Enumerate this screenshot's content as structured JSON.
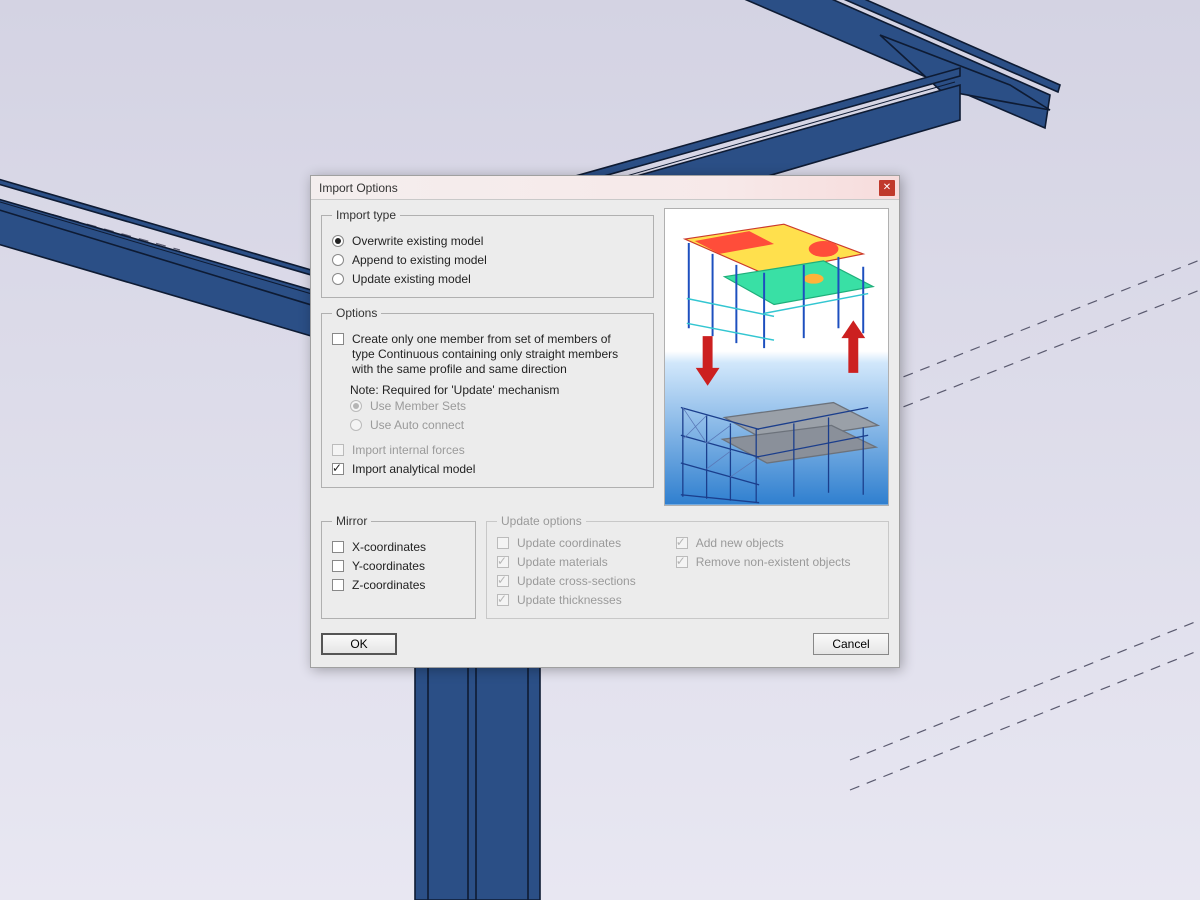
{
  "dialog": {
    "title": "Import Options",
    "close_glyph": "✕",
    "import_type": {
      "legend": "Import type",
      "options": [
        {
          "label": "Overwrite existing model",
          "selected": true
        },
        {
          "label": "Append to existing model",
          "selected": false
        },
        {
          "label": "Update existing model",
          "selected": false
        }
      ]
    },
    "options": {
      "legend": "Options",
      "create_one_member": {
        "label": "Create only one member from set of members of type Continuous containing only straight members with the same profile and same direction",
        "checked": false
      },
      "note": "Note: Required for 'Update' mechanism",
      "sub_use_member_sets": {
        "label": "Use Member Sets",
        "selected": true,
        "enabled": false
      },
      "sub_use_auto_connect": {
        "label": "Use Auto connect",
        "selected": false,
        "enabled": false
      },
      "import_internal_forces": {
        "label": "Import internal forces",
        "checked": false,
        "enabled": false
      },
      "import_analytical_model": {
        "label": "Import analytical model",
        "checked": true,
        "enabled": true
      }
    },
    "mirror": {
      "legend": "Mirror",
      "items": [
        {
          "label": "X-coordinates",
          "checked": false
        },
        {
          "label": "Y-coordinates",
          "checked": false
        },
        {
          "label": "Z-coordinates",
          "checked": false
        }
      ]
    },
    "update_options": {
      "legend": "Update options",
      "enabled": false,
      "col1": [
        {
          "label": "Update coordinates",
          "checked": false
        },
        {
          "label": "Update materials",
          "checked": true
        },
        {
          "label": "Update cross-sections",
          "checked": true
        },
        {
          "label": "Update thicknesses",
          "checked": true
        }
      ],
      "col2": [
        {
          "label": "Add new objects",
          "checked": true
        },
        {
          "label": "Remove non-existent objects",
          "checked": true
        }
      ]
    },
    "buttons": {
      "ok": "OK",
      "cancel": "Cancel"
    }
  }
}
